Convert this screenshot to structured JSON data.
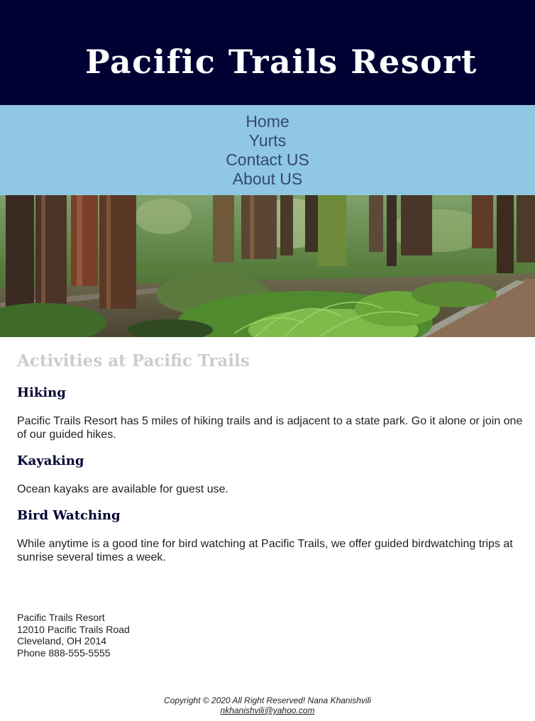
{
  "header": {
    "title": "Pacific Trails Resort",
    "background_color": "#000033"
  },
  "nav": {
    "background_color": "#90c7e3",
    "items": [
      {
        "label": "Home"
      },
      {
        "label": "Yurts"
      },
      {
        "label": "Contact US"
      },
      {
        "label": "About US"
      }
    ]
  },
  "hero": {
    "image_subject": "redwood forest trail with ferns"
  },
  "main": {
    "heading": "Activities at Pacific Trails",
    "sections": [
      {
        "title": "Hiking",
        "text": "Pacific Trails Resort has 5 miles of hiking trails and is adjacent to a state park. Go it alone or join one of our guided hikes."
      },
      {
        "title": "Kayaking",
        "text": "Ocean kayaks are available for guest use."
      },
      {
        "title": "Bird Watching",
        "text": "While anytime is a good tine for bird watching at Pacific Trails, we offer guided birdwatching trips at sunrise several times a week."
      }
    ]
  },
  "address": {
    "name": "Pacific Trails Resort",
    "street": "12010 Pacific Trails Road",
    "city": "Cleveland, OH 2014",
    "phone": "Phone 888-555-5555"
  },
  "footer": {
    "copyright": "Copyright © 2020 All Right Reserved! Nana Khanishvili",
    "email": "nkhanishvili@yahoo.com"
  }
}
